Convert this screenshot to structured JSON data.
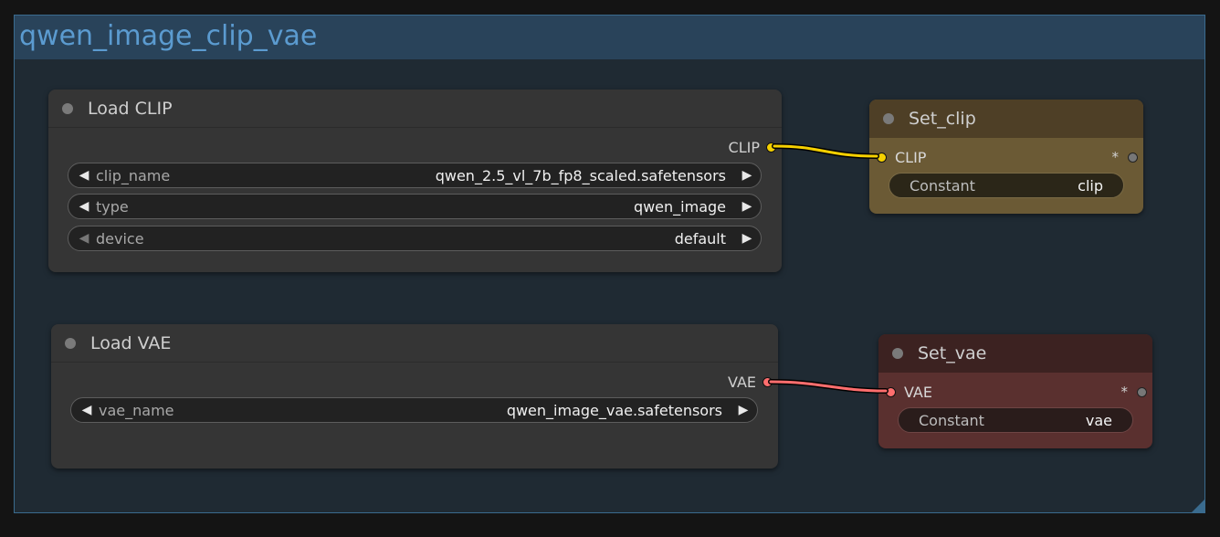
{
  "group": {
    "title": "qwen_image_clip_vae"
  },
  "load_clip": {
    "title": "Load CLIP",
    "output_label": "CLIP",
    "widgets": [
      {
        "name": "clip_name",
        "value": "qwen_2.5_vl_7b_fp8_scaled.safetensors"
      },
      {
        "name": "type",
        "value": "qwen_image"
      },
      {
        "name": "device",
        "value": "default"
      }
    ]
  },
  "load_vae": {
    "title": "Load VAE",
    "output_label": "VAE",
    "widgets": [
      {
        "name": "vae_name",
        "value": "qwen_image_vae.safetensors"
      }
    ]
  },
  "set_clip": {
    "title": "Set_clip",
    "input_label": "CLIP",
    "output_label": "*",
    "constant_name": "Constant",
    "constant_value": "clip"
  },
  "set_vae": {
    "title": "Set_vae",
    "input_label": "VAE",
    "output_label": "*",
    "constant_name": "Constant",
    "constant_value": "vae"
  },
  "icons": {
    "arrow_left": "◀",
    "arrow_right": "▶"
  },
  "colors": {
    "clip_link": "#f5d000",
    "vae_link": "#ff6e6e",
    "set_clip_body": "#6b5a35",
    "set_clip_header": "#4e3f26",
    "set_vae_body": "#5a302f",
    "set_vae_header": "#3c2221"
  }
}
